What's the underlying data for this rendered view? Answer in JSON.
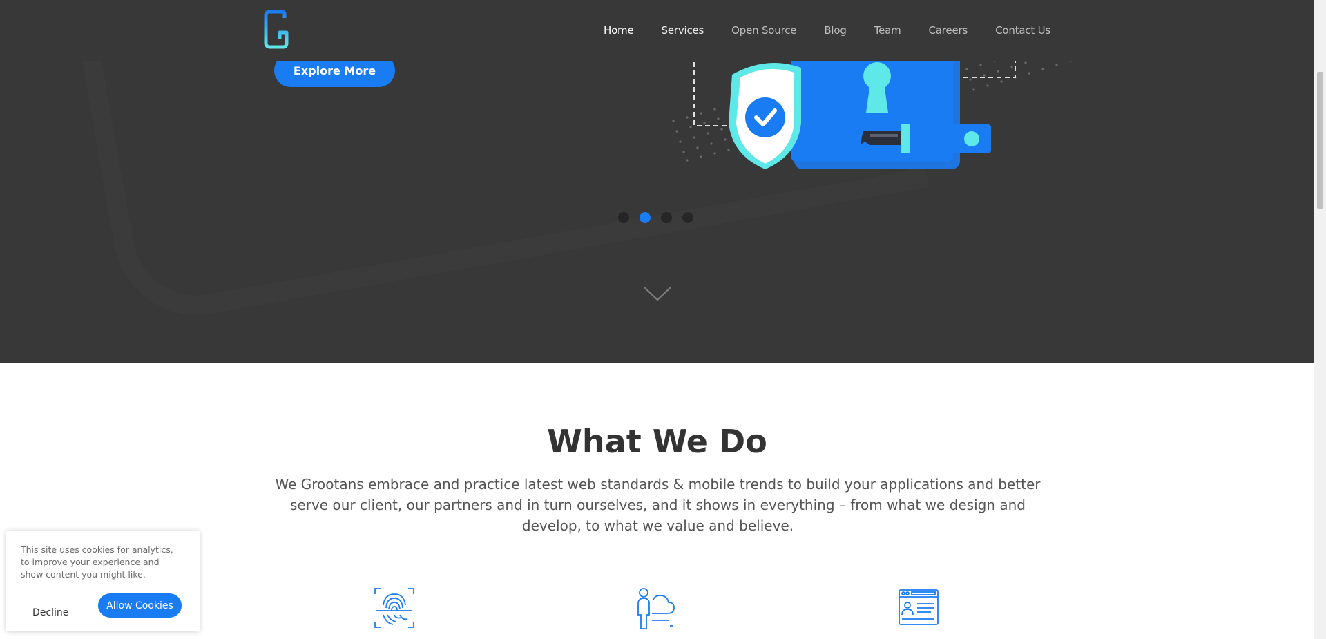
{
  "header": {
    "logo_letter": "G",
    "nav": [
      {
        "label": "Home"
      },
      {
        "label": "Services"
      },
      {
        "label": "Open Source"
      },
      {
        "label": "Blog"
      },
      {
        "label": "Team"
      },
      {
        "label": "Careers"
      },
      {
        "label": "Contact Us"
      }
    ]
  },
  "hero": {
    "explore_label": "Explore More",
    "carousel": {
      "count": 4,
      "active_index": 1
    },
    "illustration": {
      "icons": [
        "shield-check-icon",
        "lock-keyhole-icon",
        "key-icon"
      ]
    },
    "scroll_icon": "chevron-down-icon"
  },
  "what_we_do": {
    "title": "What We Do",
    "description": "We Grootans embrace and practice latest web standards & mobile trends to build your applications and better serve our client, our partners and in turn ourselves, and it shows in everything – from what we design and develop, to what we value and believe.",
    "service_icons": [
      "fingerprint-icon",
      "person-cloud-icon",
      "browser-profile-icon"
    ]
  },
  "cookie_banner": {
    "text": "This site uses cookies for analytics, to improve your experience and show content you might like.",
    "decline_label": "Decline",
    "allow_label": "Allow Cookies"
  },
  "colors": {
    "accent": "#1a7cf3",
    "hero_bg": "#383838",
    "cyan": "#5ee8e8"
  }
}
